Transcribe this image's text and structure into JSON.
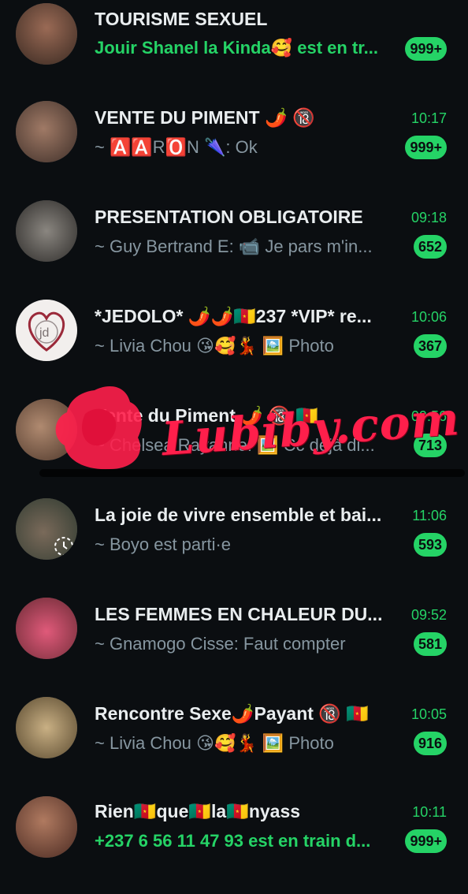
{
  "chats": [
    {
      "title": "TOURISME SEXUEL",
      "time": "",
      "preview": "Jouir Shanel la Kinda🥰 est en tr...",
      "preview_green": true,
      "badge": "999+",
      "avatar_color": "#6b4a3a"
    },
    {
      "title": "VENTE DU PIMENT 🌶️ 🔞",
      "time": "10:17",
      "preview": "~ 🅰️🅰️R🅾️N 🌂: Ok",
      "preview_green": false,
      "badge": "999+",
      "avatar_color": "#7a5a4c"
    },
    {
      "title": "PRESENTATION OBLIGATOIRE",
      "time": "09:18",
      "preview": "~ Guy Bertrand E: 📹 Je pars m'in...",
      "preview_green": false,
      "badge": "652",
      "avatar_color": "#55534f"
    },
    {
      "title": "*JEDOLO* 🌶️🌶️🇨🇲237 *VIP* re...",
      "time": "10:06",
      "preview": "~ Livia Chou 😘🥰💃 🖼️ Photo",
      "preview_green": false,
      "badge": "367",
      "avatar_color": "#e8e4e2"
    },
    {
      "title": "Vente du Piment 🌶️ 🔞 🇨🇲",
      "time": "09:56",
      "preview": "~ Chelsea Rayanne: 🖼️ Cc déjà di...",
      "preview_green": false,
      "badge": "713",
      "avatar_color": "#8a6a58"
    },
    {
      "title": "La joie de vivre ensemble et bai...",
      "time": "11:06",
      "preview": "~ Boyo est parti·e",
      "preview_green": false,
      "badge": "593",
      "avatar_color": "#4f6a55"
    },
    {
      "title": "LES FEMMES EN CHALEUR DU...",
      "time": "09:52",
      "preview": "~ Gnamogo Cisse: Faut compter",
      "preview_green": false,
      "badge": "581",
      "avatar_color": "#b0586a"
    },
    {
      "title": "Rencontre Sexe🌶️Payant 🔞 🇨🇲",
      "time": "10:05",
      "preview": "~ Livia Chou 😘🥰💃 🖼️ Photo",
      "preview_green": false,
      "badge": "916",
      "avatar_color": "#8c7a52"
    },
    {
      "title": "Rien🇨🇲que🇨🇲la🇨🇲nyass",
      "time": "10:11",
      "preview": "+237 6 56 11 47 93 est en train d...",
      "preview_green": true,
      "badge": "999+",
      "avatar_color": "#7a4a3a"
    }
  ],
  "watermark": {
    "text": "Lubiby.com",
    "color": "#ff1f4b"
  }
}
